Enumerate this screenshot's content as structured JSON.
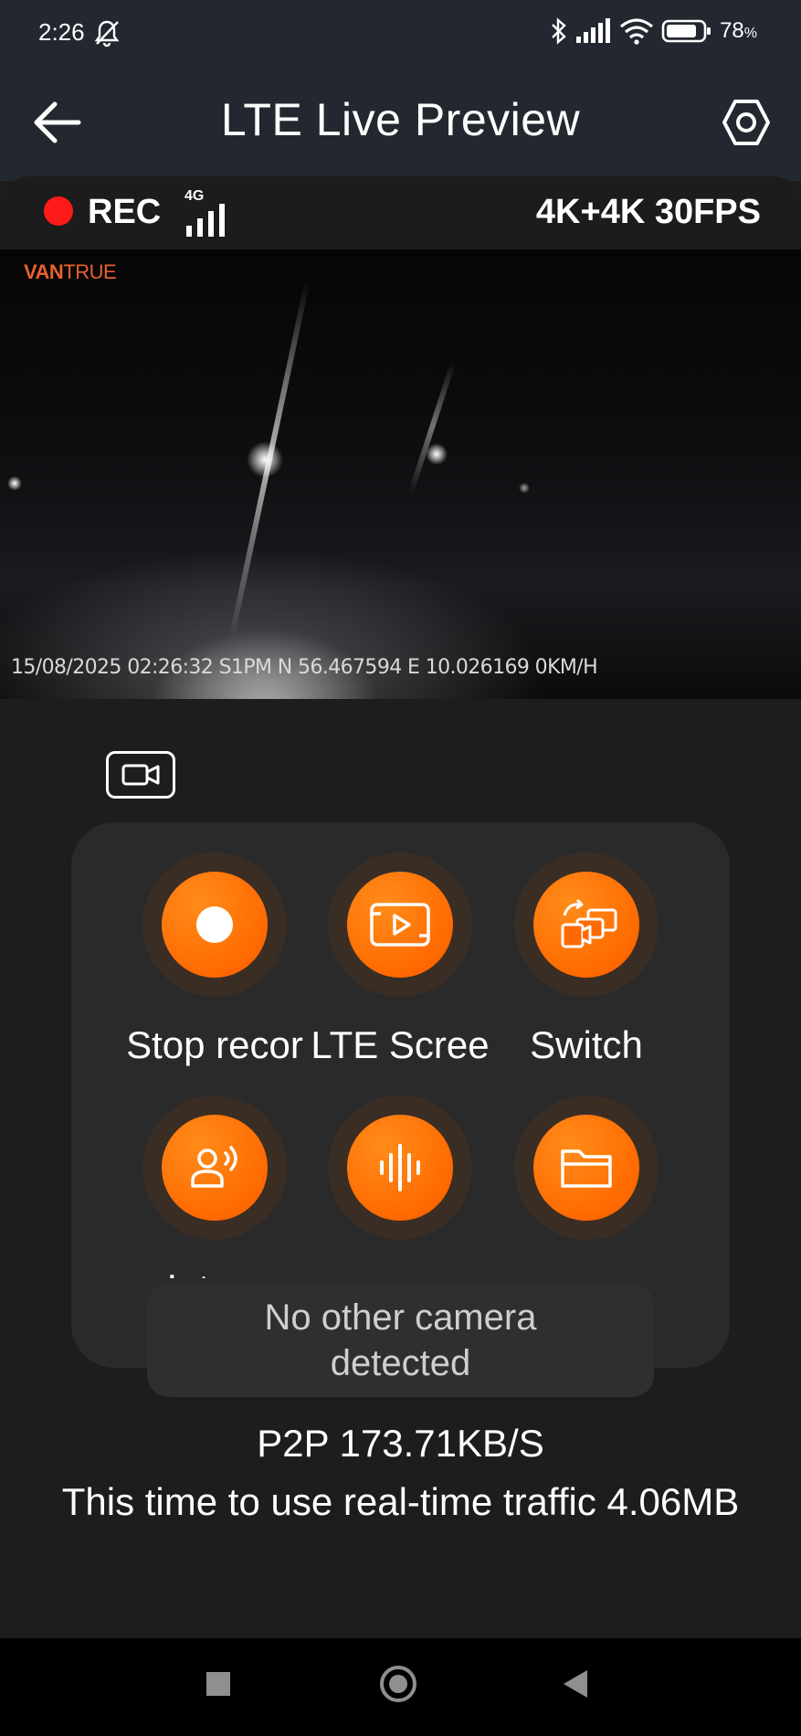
{
  "status_bar": {
    "time": "2:26",
    "battery_percent": "78",
    "icons": [
      "bell-muted-icon",
      "bluetooth-icon",
      "cell-signal-icon",
      "wifi-icon",
      "battery-icon"
    ]
  },
  "header": {
    "title": "LTE Live Preview",
    "back_icon": "arrow-left-icon",
    "settings_icon": "gear-icon"
  },
  "recording": {
    "rec_label": "REC",
    "network": "4G",
    "resolution": "4K+4K 30FPS"
  },
  "video": {
    "brand_bold": "VAN",
    "brand_light": "TRUE",
    "overlay": "15/08/2025 02:26:32 S1PM N 56.467594 E 10.026169 0KM/H"
  },
  "actions": [
    {
      "label": "Stop recor",
      "icon": "record-dot-icon"
    },
    {
      "label": "LTE Scree",
      "icon": "play-screen-icon"
    },
    {
      "label": "Switch Came",
      "icon": "switch-camera-icon"
    },
    {
      "label": "Interc",
      "icon": "intercom-icon"
    },
    {
      "label": "",
      "icon": "sound-wave-icon"
    },
    {
      "label": "",
      "icon": "folder-icon"
    }
  ],
  "toast": {
    "line1": "No other camera",
    "line2": "detected"
  },
  "stats": {
    "p2p": "P2P 173.71KB/S",
    "traffic": "This time to use real-time traffic 4.06MB"
  },
  "colors": {
    "accent": "#ff6a00",
    "rec_red": "#ff1a1a",
    "header_bg": "#232830",
    "panel_bg": "#2a2a2b"
  }
}
